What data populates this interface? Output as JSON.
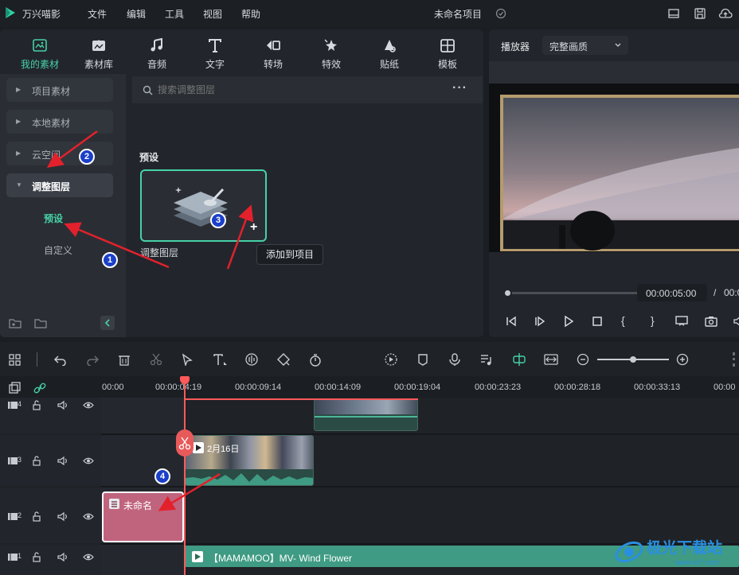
{
  "app": {
    "name": "万兴喵影",
    "project_title": "未命名项目"
  },
  "menu": [
    "文件",
    "编辑",
    "工具",
    "视图",
    "帮助"
  ],
  "tabs": [
    {
      "label": "我的素材",
      "icon": "my-media-icon",
      "active": true
    },
    {
      "label": "素材库",
      "icon": "stock-media-icon"
    },
    {
      "label": "音频",
      "icon": "music-note-icon"
    },
    {
      "label": "文字",
      "icon": "text-icon"
    },
    {
      "label": "转场",
      "icon": "transition-icon"
    },
    {
      "label": "特效",
      "icon": "effects-icon"
    },
    {
      "label": "贴纸",
      "icon": "sticker-icon"
    },
    {
      "label": "模板",
      "icon": "template-icon"
    }
  ],
  "sidebar": {
    "items": [
      "项目素材",
      "本地素材",
      "云空间",
      "调整图层"
    ],
    "sub_items": [
      "预设",
      "自定义"
    ]
  },
  "search": {
    "placeholder": "搜索调整图层"
  },
  "section": {
    "title": "预设"
  },
  "card": {
    "label": "调整图层",
    "tooltip": "添加到项目",
    "add_symbol": "+"
  },
  "player": {
    "label": "播放器",
    "quality": "完整画质",
    "time_current": "00:00:05:00",
    "time_sep": "/",
    "time_total_partial": "00:0"
  },
  "ruler": [
    "00:00",
    "00:00:04:19",
    "00:00:09:14",
    "00:00:14:09",
    "00:00:19:04",
    "00:00:23:23",
    "00:00:28:18",
    "00:00:33:13",
    "00:00"
  ],
  "tracks": [
    {
      "num": "4"
    },
    {
      "num": "3"
    },
    {
      "num": "2"
    },
    {
      "num": "1"
    }
  ],
  "clips": {
    "video_clip_label": "2月16日",
    "adjust_clip_label": "未命名",
    "audio_clip_label": "【MAMAMOO】MV- Wind Flower"
  },
  "annotations": [
    "1",
    "2",
    "3",
    "4"
  ],
  "watermark": {
    "text": "极光下载站",
    "url": "www.xz7.com"
  },
  "colors": {
    "accent": "#46d1a7",
    "playhead": "#ff5a5a",
    "adjust_clip": "#c0647e",
    "audio_clip": "#3f9b83",
    "annotation_arrow": "#e3212c",
    "badge": "#1b3fc9"
  }
}
